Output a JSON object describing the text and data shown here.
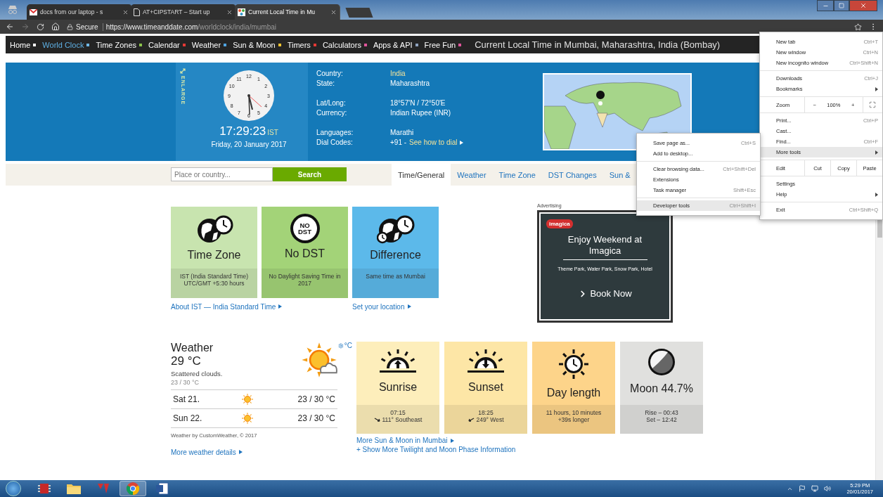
{
  "browser": {
    "tabs": [
      {
        "title": "docs from our laptop - s",
        "kind": "mail",
        "selected": false
      },
      {
        "title": "AT+CIPSTART – Start up",
        "kind": "document",
        "selected": false
      },
      {
        "title": "Current Local Time in Mu",
        "kind": "site",
        "selected": true
      }
    ],
    "address": {
      "secure": "Secure",
      "host": "https://www.timeanddate.com",
      "path": "/worldclock/india/mumbai"
    }
  },
  "site_nav": {
    "items": [
      {
        "label": "Home",
        "selected": false,
        "color": "#ffffff"
      },
      {
        "label": "World Clock",
        "selected": true,
        "color": "#6fb8e6"
      },
      {
        "label": "Time Zones",
        "selected": false,
        "color": "#8bc34a"
      },
      {
        "label": "Calendar",
        "selected": false,
        "color": "#e53935"
      },
      {
        "label": "Weather",
        "selected": false,
        "color": "#4fa3e0"
      },
      {
        "label": "Sun & Moon",
        "selected": false,
        "color": "#f4c430"
      },
      {
        "label": "Timers",
        "selected": false,
        "color": "#e53935"
      },
      {
        "label": "Calculators",
        "selected": false,
        "color": "#e0559a"
      },
      {
        "label": "Apps & API",
        "selected": false,
        "color": "#8fa3c0"
      },
      {
        "label": "Free Fun",
        "selected": false,
        "color": "#e0559a"
      }
    ],
    "title": "Current Local Time in Mumbai, Maharashtra, India",
    "title_note": "(Bombay)"
  },
  "hero": {
    "enlarge": "ENLARGE",
    "clock_numbers": [
      "12",
      "1",
      "2",
      "3",
      "4",
      "5",
      "6",
      "7",
      "8",
      "9",
      "10",
      "11"
    ],
    "time": "17:29:23",
    "zone": "IST",
    "date": "Friday, 20 January 2017",
    "fact_groups": [
      [
        {
          "label": "Country:",
          "value": "India",
          "kind": "link"
        },
        {
          "label": "State:",
          "value": "Maharashtra",
          "kind": "text"
        }
      ],
      [
        {
          "label": "Lat/Long:",
          "value": "18°57'N / 72°50'E",
          "kind": "text"
        },
        {
          "label": "Currency:",
          "value": "Indian Rupee (INR)",
          "kind": "text"
        }
      ],
      [
        {
          "label": "Languages:",
          "value": "Marathi",
          "kind": "text"
        },
        {
          "label": "Dial Codes:",
          "value": "+91 -",
          "kind": "text",
          "link": "See how to dial"
        }
      ]
    ]
  },
  "search": {
    "placeholder": "Place or country...",
    "button": "Search"
  },
  "page_tabs": [
    {
      "label": "Time/General",
      "selected": true
    },
    {
      "label": "Weather",
      "selected": false
    },
    {
      "label": "Time Zone",
      "selected": false
    },
    {
      "label": "DST Changes",
      "selected": false
    },
    {
      "label": "Sun &",
      "selected": false
    }
  ],
  "cards": [
    {
      "kind": "timezone",
      "title": "Time Zone",
      "lines": [
        "IST (India Standard Time)",
        "UTC/GMT +5:30 hours"
      ],
      "color": "#c8e4af",
      "link": "About IST — India Standard Time"
    },
    {
      "kind": "badge",
      "badge": "NO DST",
      "title": "No DST",
      "lines": [
        "No Daylight Saving Time in 2017"
      ],
      "color": "#a3d378"
    },
    {
      "kind": "difference",
      "title": "Difference",
      "lines": [
        "Same time as Mumbai"
      ],
      "color": "#5cb9ea",
      "link": "Set your location"
    }
  ],
  "ad": {
    "label": "Advertising",
    "brand": "imagica",
    "headline": "Enjoy Weekend at Imagica",
    "subline": "Theme Park, Water Park, Snow Park, Hotel",
    "cta": "Book Now"
  },
  "weather": {
    "title": "Weather",
    "temp": "29 °C",
    "summary": "Scattered clouds.",
    "range": "23 / 30 °C",
    "unit": "°C",
    "forecast": [
      {
        "day": "Sat 21.",
        "temp": "23 / 30 °C"
      },
      {
        "day": "Sun 22.",
        "temp": "23 / 30 °C"
      }
    ],
    "credit": "Weather by CustomWeather, © 2017",
    "link": "More weather details"
  },
  "sun_cards": [
    {
      "kind": "sunrise",
      "title": "Sunrise",
      "color": "#fdeebb",
      "lines": [
        {
          "text": "07:15"
        },
        {
          "text": "111° Southeast",
          "kind": "bearing"
        }
      ]
    },
    {
      "kind": "sunset",
      "title": "Sunset",
      "color": "#fde6a6",
      "lines": [
        {
          "text": "18:25"
        },
        {
          "text": "249° West",
          "kind": "bearing"
        }
      ]
    },
    {
      "kind": "daylength",
      "title": "Day length",
      "color": "#fdd48a",
      "lines": [
        {
          "text": "11 hours, 10 minutes"
        },
        {
          "text": "+39s longer"
        }
      ]
    },
    {
      "kind": "moon",
      "title": "Moon 44.7%",
      "color": "#e0e0de",
      "lines": [
        {
          "text": "Rise – 00:43"
        },
        {
          "text": "Set – 12:42"
        }
      ]
    }
  ],
  "sun_links": [
    "More Sun & Moon in Mumbai",
    "+ Show More Twilight and Moon Phase Information"
  ],
  "chrome_menu": {
    "groups": [
      [
        {
          "kind": "item",
          "label": "New tab",
          "shortcut": "Ctrl+T",
          "submenu": false,
          "highlighted": false
        },
        {
          "kind": "item",
          "label": "New window",
          "shortcut": "Ctrl+N",
          "submenu": false,
          "highlighted": false
        },
        {
          "kind": "item",
          "label": "New incognito window",
          "shortcut": "Ctrl+Shift+N",
          "submenu": false,
          "highlighted": false
        }
      ],
      [
        {
          "kind": "item",
          "label": "Downloads",
          "shortcut": "Ctrl+J",
          "submenu": false,
          "highlighted": false
        },
        {
          "kind": "item",
          "label": "Bookmarks",
          "submenu": true,
          "highlighted": false
        }
      ],
      [
        {
          "kind": "zoom",
          "label": "Zoom",
          "minus": "−",
          "value": "100%",
          "plus": "+"
        }
      ],
      [
        {
          "kind": "item",
          "label": "Print...",
          "shortcut": "Ctrl+P",
          "submenu": false,
          "highlighted": false
        },
        {
          "kind": "item",
          "label": "Cast...",
          "submenu": false,
          "highlighted": false
        },
        {
          "kind": "item",
          "label": "Find...",
          "shortcut": "Ctrl+F",
          "submenu": false,
          "highlighted": false
        },
        {
          "kind": "item",
          "label": "More tools",
          "submenu": true,
          "highlighted": true
        }
      ],
      [
        {
          "kind": "edit",
          "label": "Edit",
          "actions": [
            "Cut",
            "Copy",
            "Paste"
          ]
        }
      ],
      [
        {
          "kind": "item",
          "label": "Settings",
          "submenu": false,
          "highlighted": false
        },
        {
          "kind": "item",
          "label": "Help",
          "submenu": true,
          "highlighted": false
        }
      ],
      [
        {
          "kind": "item",
          "label": "Exit",
          "shortcut": "Ctrl+Shift+Q",
          "submenu": false,
          "highlighted": false
        }
      ]
    ]
  },
  "more_tools_menu": {
    "groups": [
      [
        {
          "label": "Save page as...",
          "shortcut": "Ctrl+S",
          "highlighted": false
        },
        {
          "label": "Add to desktop...",
          "highlighted": false
        }
      ],
      [
        {
          "label": "Clear browsing data...",
          "shortcut": "Ctrl+Shift+Del",
          "highlighted": false
        },
        {
          "label": "Extensions",
          "highlighted": false
        },
        {
          "label": "Task manager",
          "shortcut": "Shift+Esc",
          "highlighted": false
        }
      ],
      [
        {
          "label": "Developer tools",
          "shortcut": "Ctrl+Shift+I",
          "highlighted": true
        }
      ]
    ]
  },
  "taskbar": {
    "apps": [
      {
        "kind": "chip",
        "active": false
      },
      {
        "kind": "folder",
        "active": false
      },
      {
        "kind": "compiler",
        "active": false
      },
      {
        "kind": "chrome",
        "active": true
      },
      {
        "kind": "word",
        "active": false
      }
    ],
    "time": "5:29 PM",
    "date": "20/01/2017"
  }
}
